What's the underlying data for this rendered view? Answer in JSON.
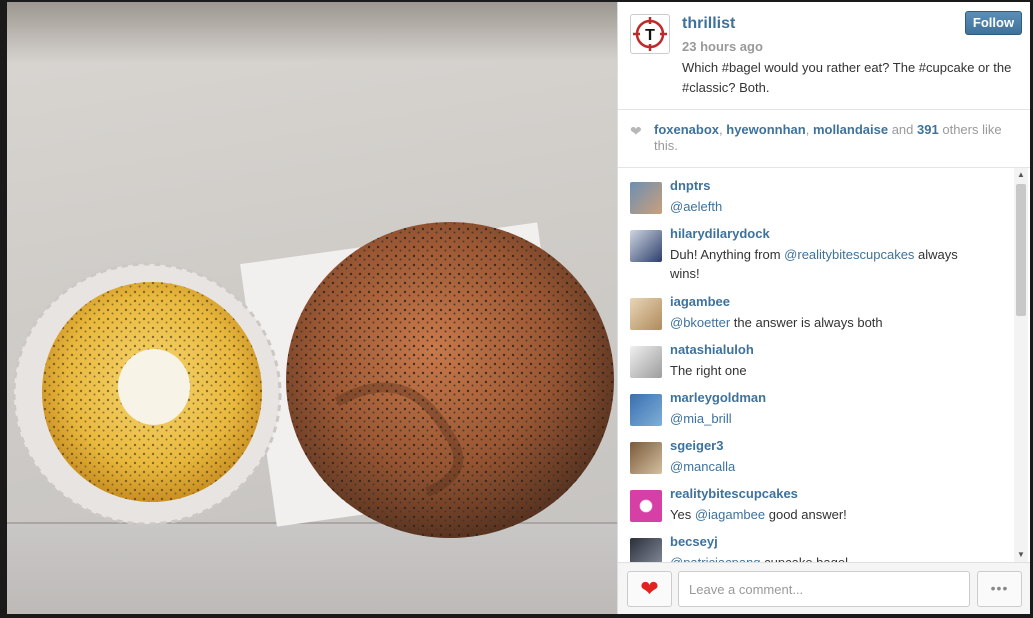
{
  "post": {
    "username": "thrillist",
    "time": "23 hours ago",
    "caption": "Which #bagel would you rather eat? The #cupcake or the #classic? Both.",
    "follow_label": "Follow"
  },
  "likes": {
    "users": [
      "foxenabox",
      "hyewonnhan",
      "mollandaise"
    ],
    "and_text": "and",
    "count": "391",
    "suffix": "others like this."
  },
  "comments": [
    {
      "user": "dnptrs",
      "text_parts": [
        {
          "t": "@aelefth",
          "m": true
        }
      ]
    },
    {
      "user": "hilarydilarydock",
      "text_parts": [
        {
          "t": "Duh! Anything from ",
          "m": false
        },
        {
          "t": "@realitybitescupcakes",
          "m": true
        },
        {
          "t": " always wins!",
          "m": false
        }
      ]
    },
    {
      "user": "iagambee",
      "text_parts": [
        {
          "t": "@bkoetter",
          "m": true
        },
        {
          "t": " the answer is always both",
          "m": false
        }
      ]
    },
    {
      "user": "natashialuloh",
      "text_parts": [
        {
          "t": "The right one",
          "m": false
        }
      ]
    },
    {
      "user": "marleygoldman",
      "text_parts": [
        {
          "t": "@mia_brill",
          "m": true
        }
      ]
    },
    {
      "user": "sgeiger3",
      "text_parts": [
        {
          "t": "@mancalla",
          "m": true
        }
      ]
    },
    {
      "user": "realitybitescupcakes",
      "text_parts": [
        {
          "t": "Yes ",
          "m": false
        },
        {
          "t": "@iagambee",
          "m": true
        },
        {
          "t": " good answer!",
          "m": false
        }
      ]
    },
    {
      "user": "becseyj",
      "text_parts": [
        {
          "t": "@patriciacpang",
          "m": true
        },
        {
          "t": " cupcake bagel",
          "m": false
        }
      ]
    }
  ],
  "footer": {
    "comment_placeholder": "Leave a comment...",
    "more_label": "•••"
  },
  "icons": {
    "like": "heart-icon",
    "more": "ellipsis-icon"
  },
  "colors": {
    "link": "#3f729b",
    "heart": "#e0231f"
  }
}
